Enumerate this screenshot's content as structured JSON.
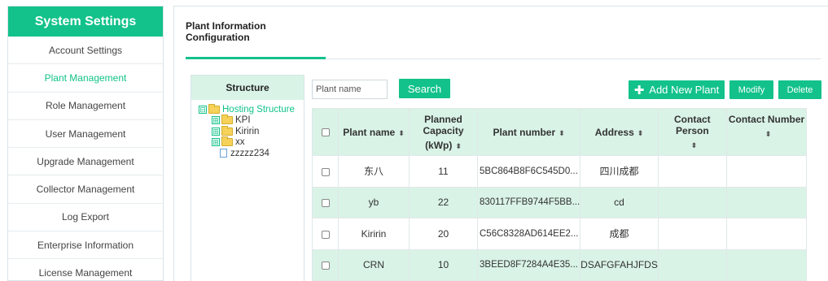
{
  "sidebar": {
    "title": "System Settings",
    "items": [
      {
        "label": "Account Settings"
      },
      {
        "label": "Plant Management"
      },
      {
        "label": "Role Management"
      },
      {
        "label": "User Management"
      },
      {
        "label": "Upgrade Management"
      },
      {
        "label": "Collector Management"
      },
      {
        "label": "Log Export"
      },
      {
        "label": "Enterprise Information"
      },
      {
        "label": "License Management"
      }
    ],
    "active_index": 1
  },
  "tabs": [
    {
      "label": "Plant Information Configuration"
    }
  ],
  "structure": {
    "title": "Structure",
    "root": {
      "expander": "⊟",
      "label": "Hosting Structure"
    },
    "children": [
      {
        "expander": "⊞",
        "label": "KPI"
      },
      {
        "expander": "⊞",
        "label": "Kiririn"
      },
      {
        "expander": "⊞",
        "label": "xx"
      },
      {
        "label": "zzzzz234"
      }
    ]
  },
  "search": {
    "placeholder": "Plant name",
    "button_label": "Search"
  },
  "actions": {
    "add_label": "Add New Plant",
    "add_glyph": "✚",
    "modify_label": "Modify",
    "delete_label": "Delete"
  },
  "table": {
    "columns": [
      {
        "label": "Plant name",
        "sort": "⬍"
      },
      {
        "label": "Planned Capacity",
        "label2": "(kWp)",
        "sort": "⬍"
      },
      {
        "label": "Plant number",
        "sort": "⬍"
      },
      {
        "label": "Address",
        "sort": "⬍"
      },
      {
        "label": "Contact Person",
        "sort": "⬍"
      },
      {
        "label": "Contact Number",
        "sort": "⬍"
      }
    ],
    "rows": [
      {
        "name": "东八",
        "capacity": "11",
        "number": "5BC864B8F6C545D0...",
        "address": "四川成都",
        "contact": "",
        "phone": ""
      },
      {
        "name": "yb",
        "capacity": "22",
        "number": "830117FFB9744F5BB...",
        "address": "cd",
        "contact": "",
        "phone": ""
      },
      {
        "name": "Kiririn",
        "capacity": "20",
        "number": "C56C8328AD614EE2...",
        "address": "成都",
        "contact": "",
        "phone": ""
      },
      {
        "name": "CRN",
        "capacity": "10",
        "number": "3BEED8F7284A4E35...",
        "address": "DSAFGFAHJFDS",
        "contact": "",
        "phone": ""
      }
    ]
  },
  "colors": {
    "accent": "#12c28a",
    "accent_light": "#d9f3e6"
  }
}
